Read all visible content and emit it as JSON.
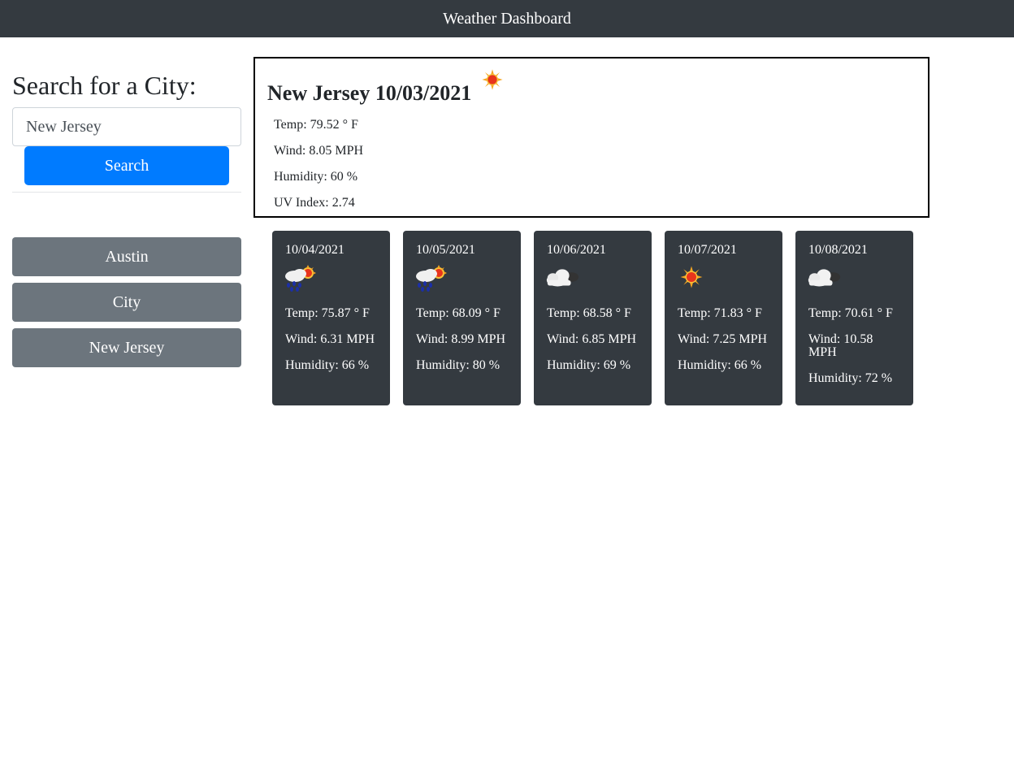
{
  "header": {
    "title": "Weather Dashboard"
  },
  "search": {
    "heading": "Search for a City:",
    "value": "New Jersey",
    "button_label": "Search"
  },
  "history": [
    {
      "label": "Austin"
    },
    {
      "label": "City"
    },
    {
      "label": "New Jersey"
    }
  ],
  "current": {
    "title": "New Jersey 10/03/2021",
    "icon": "sun-icon",
    "temp": "Temp: 79.52 ° F",
    "wind": "Wind: 8.05 MPH",
    "humidity": "Humidity: 60 %",
    "uv": "UV Index: 2.74"
  },
  "forecast": [
    {
      "date": "10/04/2021",
      "icon": "rain-sun-icon",
      "temp": "Temp: 75.87 ° F",
      "wind": "Wind: 6.31 MPH",
      "humidity": "Humidity: 66 %"
    },
    {
      "date": "10/05/2021",
      "icon": "rain-sun-icon",
      "temp": "Temp: 68.09 ° F",
      "wind": "Wind: 8.99 MPH",
      "humidity": "Humidity: 80 %"
    },
    {
      "date": "10/06/2021",
      "icon": "cloud-icon",
      "temp": "Temp: 68.58 ° F",
      "wind": "Wind: 6.85 MPH",
      "humidity": "Humidity: 69 %"
    },
    {
      "date": "10/07/2021",
      "icon": "sun-icon",
      "temp": "Temp: 71.83 ° F",
      "wind": "Wind: 7.25 MPH",
      "humidity": "Humidity: 66 %"
    },
    {
      "date": "10/08/2021",
      "icon": "cloud-icon",
      "temp": "Temp: 70.61 ° F",
      "wind": "Wind: 10.58 MPH",
      "humidity": "Humidity: 72 %"
    }
  ],
  "colors": {
    "header_bg": "#343a40",
    "primary": "#007bff",
    "secondary": "#6c757d",
    "card_bg": "#343a40"
  }
}
